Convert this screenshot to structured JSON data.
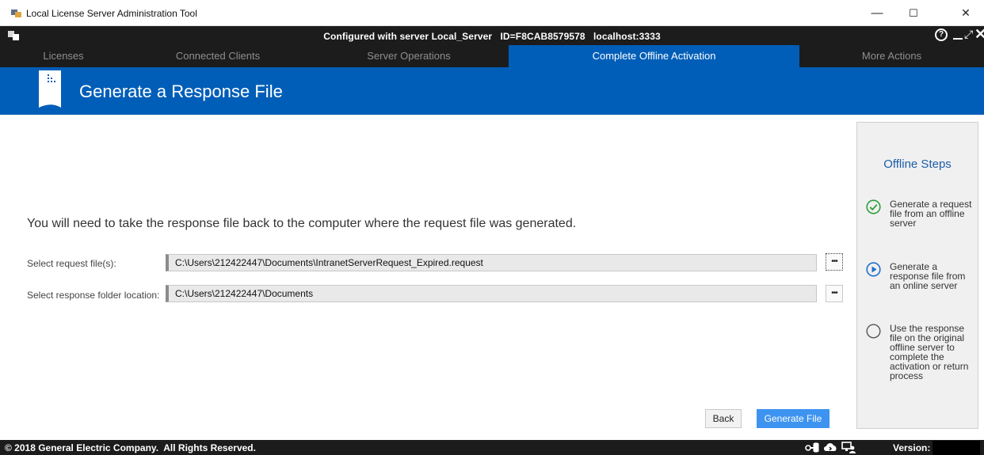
{
  "window": {
    "title": "Local License Server Administration Tool",
    "controls": {
      "minimize": "—",
      "maximize": "☐",
      "close": "✕"
    }
  },
  "infobar": {
    "server_text": "Configured with server Local_Server   ID=F8CAB8579578   localhost:3333",
    "help_symbol": "?"
  },
  "tabs": [
    {
      "label": "Licenses",
      "active": false
    },
    {
      "label": "Connected Clients",
      "active": false
    },
    {
      "label": "Server Operations",
      "active": false
    },
    {
      "label": "Complete Offline Activation",
      "active": true
    },
    {
      "label": "More Actions",
      "active": false
    }
  ],
  "header": {
    "title": "Generate a Response File"
  },
  "main": {
    "instruction": "You will need to take the response file back to the computer where the request file was generated.",
    "request_label": "Select request file(s):",
    "request_value": "C:\\Users\\212422447\\Documents\\IntranetServerRequest_Expired.request",
    "response_label": "Select response folder location:",
    "response_value": "C:\\Users\\212422447\\Documents",
    "browse_label": "•••",
    "back_label": "Back",
    "generate_label": "Generate File"
  },
  "steps": {
    "title": "Offline Steps",
    "items": [
      {
        "text": "Generate a request file from an offline server",
        "state": "done"
      },
      {
        "text": "Generate a response file from an online server",
        "state": "current"
      },
      {
        "text": "Use the response file on the original offline server to complete the activation or return process",
        "state": "pending"
      }
    ]
  },
  "footer": {
    "copyright": "© 2018 General Electric Company.  All Rights Reserved.",
    "version_label": "Version:"
  },
  "colors": {
    "accent": "#005eb8",
    "dark_bar": "#1c1c1c",
    "primary_button": "#3d93f0",
    "steps_done": "#2e9e3d",
    "steps_current": "#1e6fd0"
  }
}
